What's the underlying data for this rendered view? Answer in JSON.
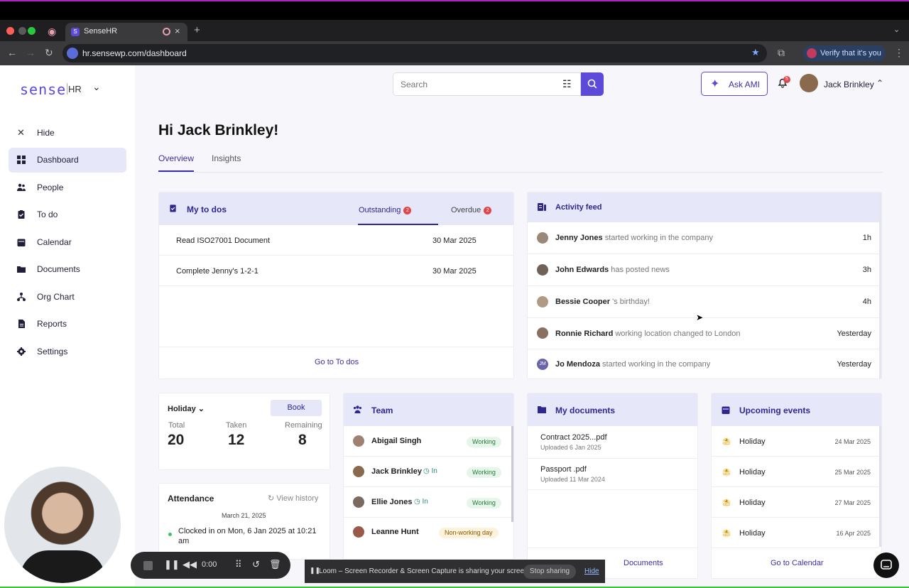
{
  "browser": {
    "tab_title": "SenseHR",
    "url": "hr.sensewp.com/dashboard",
    "verify_label": "Verify that it's you"
  },
  "brand": {
    "logo": "sense",
    "product": "HR",
    "accent": "#5b4bd8"
  },
  "sidebar": {
    "hide_label": "Hide",
    "items": [
      {
        "label": "Dashboard",
        "icon": "grid-icon",
        "active": true
      },
      {
        "label": "People",
        "icon": "people-icon"
      },
      {
        "label": "To do",
        "icon": "clipboard-icon"
      },
      {
        "label": "Calendar",
        "icon": "calendar-icon"
      },
      {
        "label": "Documents",
        "icon": "folder-icon"
      },
      {
        "label": "Org Chart",
        "icon": "org-chart-icon"
      },
      {
        "label": "Reports",
        "icon": "reports-icon"
      },
      {
        "label": "Settings",
        "icon": "gear-icon"
      }
    ]
  },
  "header": {
    "search_placeholder": "Search",
    "ask_ami": "Ask AMI",
    "notifications": "5",
    "user_name": "Jack Brinkley"
  },
  "main": {
    "greeting": "Hi Jack Brinkley!",
    "tabs": [
      "Overview",
      "Insights"
    ]
  },
  "todos": {
    "title": "My to dos",
    "tab_outstanding": "Outstanding",
    "outstanding_count": "2",
    "tab_overdue": "Overdue",
    "overdue_count": "2",
    "items": [
      {
        "label": "Read ISO27001 Document",
        "date": "30 Mar 2025"
      },
      {
        "label": "Complete Jenny's 1-2-1",
        "date": "30 Mar 2025"
      }
    ],
    "footer_link": "Go to To dos"
  },
  "activity": {
    "title": "Activity feed",
    "items": [
      {
        "name": "Jenny Jones",
        "text": "started working in the company",
        "time": "1h"
      },
      {
        "name": "John Edwards",
        "text": "has posted news",
        "time": "3h"
      },
      {
        "name": "Bessie Cooper",
        "text": "'s birthday!",
        "time": "4h"
      },
      {
        "name": "Ronnie Richard",
        "text": "working location changed to London",
        "time": "Yesterday"
      },
      {
        "name": "Jo Mendoza",
        "text": "started working in the company",
        "time": "Yesterday",
        "initials": "JM"
      }
    ]
  },
  "holiday": {
    "selector": "Holiday",
    "book": "Book",
    "total_label": "Total",
    "total": "20",
    "taken_label": "Taken",
    "taken": "12",
    "remaining_label": "Remaining",
    "remaining": "8"
  },
  "attendance": {
    "title": "Attendance",
    "history": "View history",
    "date": "March 21, 2025",
    "status": "Clocked in on Mon, 6 Jan 2025 at 10:21 am"
  },
  "team": {
    "title": "Team",
    "members": [
      {
        "name": "Abigail Singh",
        "in": "",
        "status": "Working",
        "kind": "green"
      },
      {
        "name": "Jack Brinkley",
        "in": "In",
        "status": "Working",
        "kind": "green"
      },
      {
        "name": "Ellie Jones",
        "in": "In",
        "status": "Working",
        "kind": "green"
      },
      {
        "name": "Leanne Hunt",
        "in": "",
        "status": "Non-working day",
        "kind": "amber"
      }
    ]
  },
  "documents": {
    "title": "My documents",
    "items": [
      {
        "name": "Contract 2025...pdf",
        "uploaded": "Uploaded 6 Jan 2025"
      },
      {
        "name": "Passport .pdf",
        "uploaded": "Uploaded 11 Mar 2024"
      }
    ],
    "footer_link": "Documents"
  },
  "events": {
    "title": "Upcoming events",
    "items": [
      {
        "label": "Holiday",
        "date": "24 Mar 2025"
      },
      {
        "label": "Holiday",
        "date": "25 Mar 2025"
      },
      {
        "label": "Holiday",
        "date": "27 Mar 2025"
      },
      {
        "label": "Holiday",
        "date": "16 Apr 2025"
      }
    ],
    "footer_link": "Go to Calendar"
  },
  "recorder": {
    "time": "0:00",
    "share_message": "Loom – Screen Recorder & Screen Capture is sharing your screen.",
    "stop": "Stop sharing",
    "hide": "Hide"
  }
}
